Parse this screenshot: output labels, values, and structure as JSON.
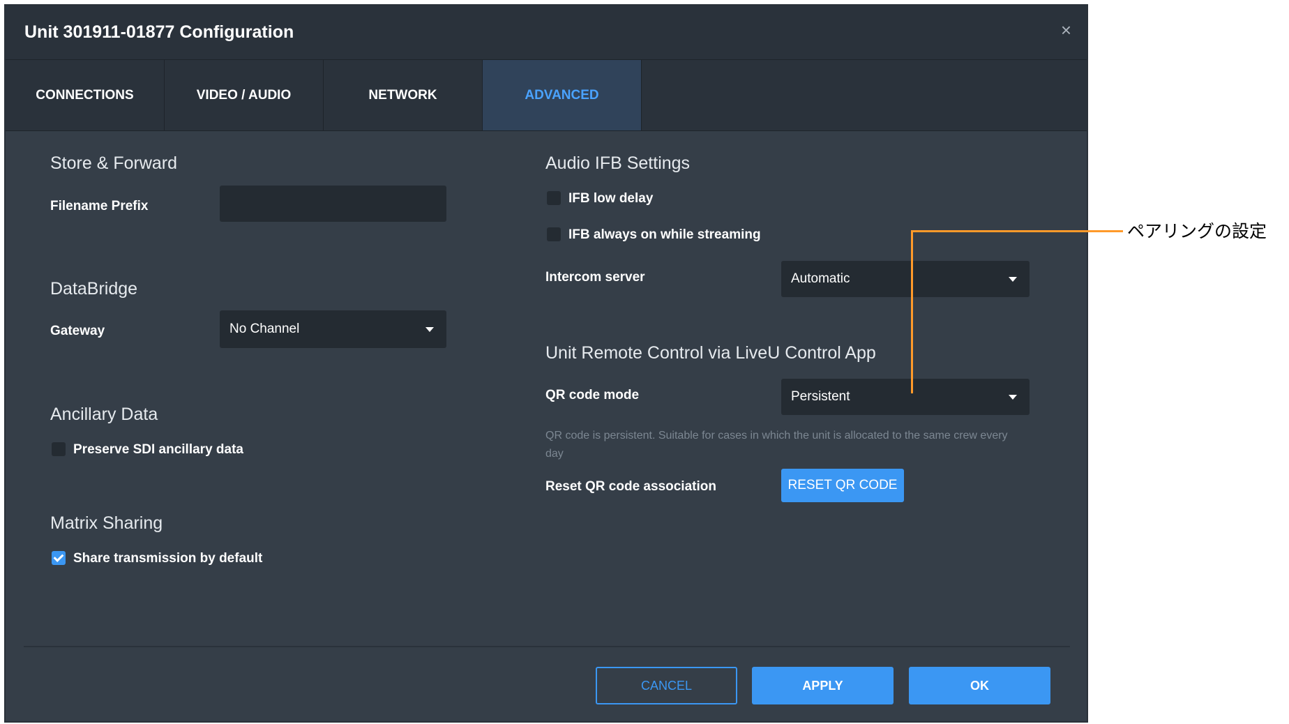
{
  "dialog": {
    "title": "Unit 301911-01877 Configuration",
    "close_symbol": "×"
  },
  "tabs": [
    {
      "label": "CONNECTIONS",
      "active": false
    },
    {
      "label": "VIDEO / AUDIO",
      "active": false
    },
    {
      "label": "NETWORK",
      "active": false
    },
    {
      "label": "ADVANCED",
      "active": true
    }
  ],
  "store_forward": {
    "heading": "Store & Forward",
    "filename_prefix_label": "Filename Prefix",
    "filename_prefix_value": ""
  },
  "databridge": {
    "heading": "DataBridge",
    "gateway_label": "Gateway",
    "gateway_value": "No Channel"
  },
  "ancillary": {
    "heading": "Ancillary Data",
    "preserve_label": "Preserve SDI ancillary data",
    "preserve_checked": false
  },
  "matrix": {
    "heading": "Matrix Sharing",
    "share_label": "Share transmission by default",
    "share_checked": true
  },
  "audio_ifb": {
    "heading": "Audio IFB Settings",
    "low_delay_label": "IFB low delay",
    "low_delay_checked": false,
    "always_on_label": "IFB always on while streaming",
    "always_on_checked": false,
    "intercom_label": "Intercom server",
    "intercom_value": "Automatic"
  },
  "remote_control": {
    "heading": "Unit Remote Control via LiveU Control App",
    "qr_mode_label": "QR code mode",
    "qr_mode_value": "Persistent",
    "qr_hint": "QR code is persistent. Suitable for cases in which the unit is allocated to the same crew every day",
    "reset_label": "Reset QR code association",
    "reset_button": "RESET QR CODE"
  },
  "footer": {
    "cancel": "CANCEL",
    "apply": "APPLY",
    "ok": "OK"
  },
  "annotation": {
    "text": "ペアリングの設定",
    "color": "#ff9a2a"
  },
  "colors": {
    "accent": "#3b97f3",
    "dialog_bg": "#353e48",
    "titlebar_bg": "#2a323b",
    "input_bg": "#242b32"
  }
}
